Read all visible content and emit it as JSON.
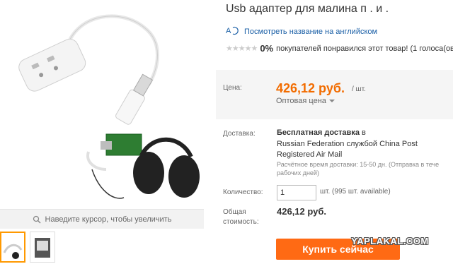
{
  "product": {
    "title": "Usb адаптер для малина п . и .",
    "translate_link": "Посмотреть название на английском",
    "rating_percent": "0%",
    "rating_text": "покупателей понравился этот товар! (1 голоса(ов)",
    "stars": "★★★★★"
  },
  "price": {
    "label": "Цена:",
    "value": "426,12 руб.",
    "unit": "/ шт.",
    "wholesale": "Оптовая цена"
  },
  "delivery": {
    "label": "Доставка:",
    "free": "Бесплатная доставка",
    "to": "в",
    "line1": "Russian Federation службой China Post",
    "line2": "Registered Air Mail",
    "time1": "Расчётное время доставки: 15-50 дн. (Отправка в тече",
    "time2": "рабочих дней)"
  },
  "quantity": {
    "label": "Количество:",
    "value": "1",
    "available": "шт. (995 шт. available)"
  },
  "total": {
    "label1": "Общая",
    "label2": "стоимость:",
    "value": "426,12 руб."
  },
  "buy_button": "Купить сейчас",
  "gallery": {
    "zoom_hint": "Наведите курсор, чтобы увеличить"
  },
  "watermark": "YAPLAKAL.COM",
  "colors": {
    "price": "#f26c00",
    "buy_button": "#ff6a14",
    "link": "#1a5fa6",
    "thumb_active_border": "#ff9900"
  }
}
